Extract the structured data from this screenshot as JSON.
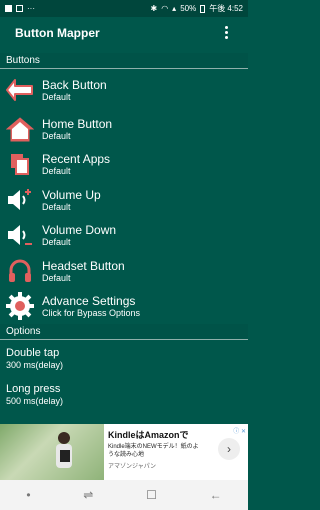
{
  "status": {
    "battery": "50%",
    "time": "午後 4:52",
    "dots": "···"
  },
  "app": {
    "title": "Button Mapper"
  },
  "sections": {
    "buttons": "Buttons",
    "options": "Options"
  },
  "buttons": [
    {
      "title": "Back Button",
      "sub": "Default",
      "icon": "back-arrow-icon"
    },
    {
      "title": "Home Button",
      "sub": "Default",
      "icon": "home-icon"
    },
    {
      "title": "Recent Apps",
      "sub": "Default",
      "icon": "recent-apps-icon"
    },
    {
      "title": "Volume Up",
      "sub": "Default",
      "icon": "volume-up-icon"
    },
    {
      "title": "Volume Down",
      "sub": "Default",
      "icon": "volume-down-icon"
    },
    {
      "title": "Headset Button",
      "sub": "Default",
      "icon": "headset-icon"
    },
    {
      "title": "Advance Settings",
      "sub": "Click for Bypass Options",
      "icon": "gear-icon"
    }
  ],
  "options": [
    {
      "title": "Double tap",
      "sub": "300 ms(delay)"
    },
    {
      "title": "Long press",
      "sub": "500 ms(delay)"
    }
  ],
  "ad": {
    "headline": "KindleはAmazonで",
    "body": "Kindle端末のNEWモデル！紙のような読み心地",
    "sponsor": "アマゾンジャパン",
    "arrow": "›",
    "info": "ⓘ ✕"
  },
  "nav": {
    "dot": "•",
    "recent": "⇌",
    "home": "☐",
    "back": "←"
  },
  "colors": {
    "accent": "#00574B",
    "icon_red": "#e0605e",
    "icon_white": "#ffffff"
  }
}
